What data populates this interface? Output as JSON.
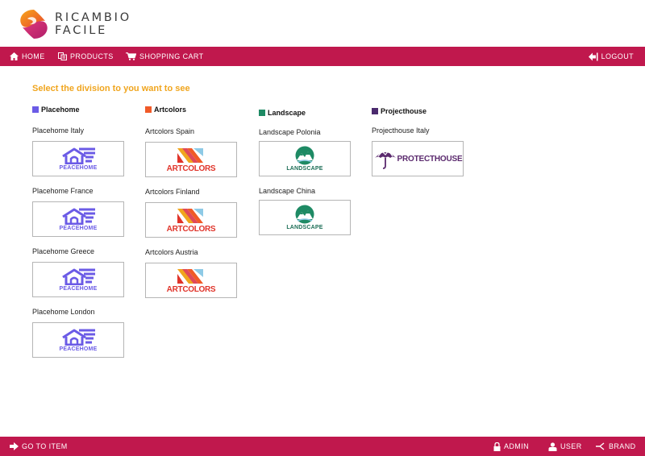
{
  "logo": {
    "line1": "RICAMBIO",
    "line2": "FACILE"
  },
  "topnav": {
    "home": "HOME",
    "products": "PRODUCTS",
    "cart": "SHOPPING CART",
    "logout": "LOGOUT"
  },
  "main": {
    "title": "Select the division to you want to see"
  },
  "colors": {
    "accent": "#c0184d",
    "title": "#f0a51e",
    "placehome": "#6b5be6",
    "artcolors": "#f05a28",
    "landscape": "#1e8a64",
    "projecthouse": "#4b2a6e"
  },
  "divisions": {
    "placehome": {
      "name": "Placehome",
      "brand": "PEACEHOME",
      "items": [
        "Placehome Italy",
        "Placehome France",
        "Placehome Greece",
        "Placehome London"
      ]
    },
    "artcolors": {
      "name": "Artcolors",
      "brand": "ARTCOLORS",
      "items": [
        "Artcolors Spain",
        "Artcolors Finland",
        "Artcolors Austria"
      ]
    },
    "landscape": {
      "name": "Landscape",
      "brand": "LANDSCAPE",
      "items": [
        "Landscape Polonia",
        "Landscape China"
      ]
    },
    "projecthouse": {
      "name": "Projecthouse",
      "brand": "PROTECTHOUSE",
      "items": [
        "Projecthouse Italy"
      ]
    }
  },
  "bottomnav": {
    "goto": "GO TO ITEM",
    "admin": "ADMIN",
    "user": "USER",
    "brand": "BRAND"
  }
}
